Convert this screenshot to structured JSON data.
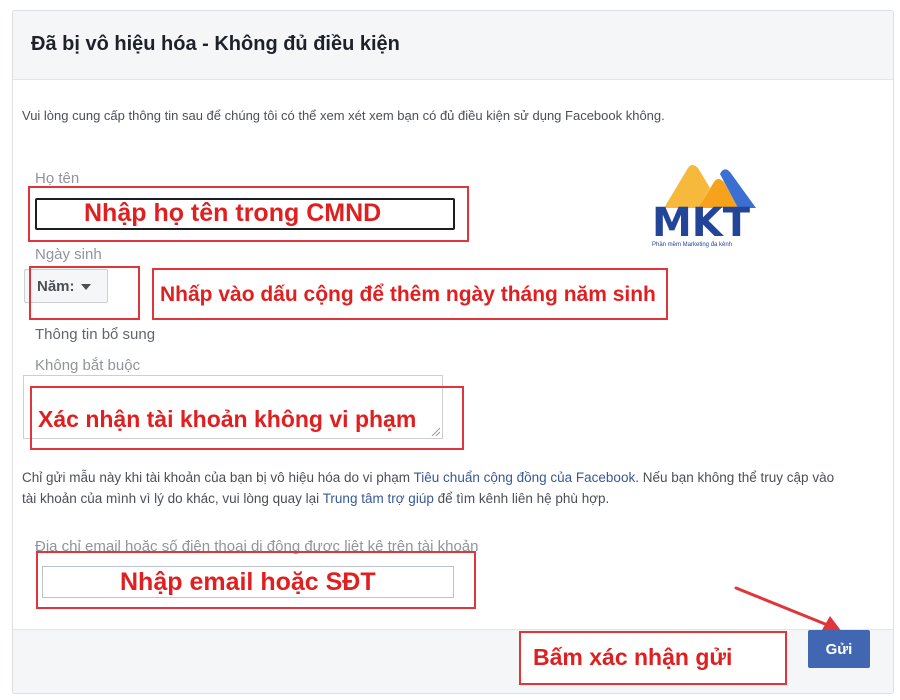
{
  "dialog": {
    "title": "Đã bị vô hiệu hóa - Không đủ điều kiện",
    "intro": "Vui lòng cung cấp thông tin sau để chúng tôi có thể xem xét xem bạn có đủ điều kiện sử dụng Facebook không."
  },
  "fields": {
    "name_label": "Họ tên",
    "dob_label": "Ngày sinh",
    "year_select": "Năm:",
    "extra_label": "Thông tin bổ sung",
    "optional_label": "Không bắt buộc",
    "contact_label": "Địa chỉ email hoặc số điện thoại di động được liệt kê trên tài khoản"
  },
  "notice": {
    "part1": "Chỉ gửi mẫu này khi tài khoản của bạn bị vô hiệu hóa do vi phạm ",
    "link1": "Tiêu chuẩn cộng đồng của Facebook",
    "part2": ". Nếu bạn không thể truy cập vào tài khoản của mình vì lý do khác, vui lòng quay lại ",
    "link2": "Trung tâm trợ giúp",
    "part3": " để tìm kênh liên hệ phù hợp."
  },
  "annotations": {
    "name": "Nhập họ tên trong CMND",
    "dob": "Nhấp vào dấu cộng để thêm ngày tháng năm sinh",
    "extra": "Xác nhận tài khoản không vi phạm",
    "contact": "Nhập email hoặc SĐT",
    "submit": "Bấm xác nhận gửi"
  },
  "logo": {
    "text": "MKT",
    "tagline": "Phần mềm Marketing đa kênh"
  },
  "buttons": {
    "send": "Gửi"
  },
  "colors": {
    "accent": "#4267b2",
    "annotation": "#e0353b",
    "link": "#385898"
  }
}
